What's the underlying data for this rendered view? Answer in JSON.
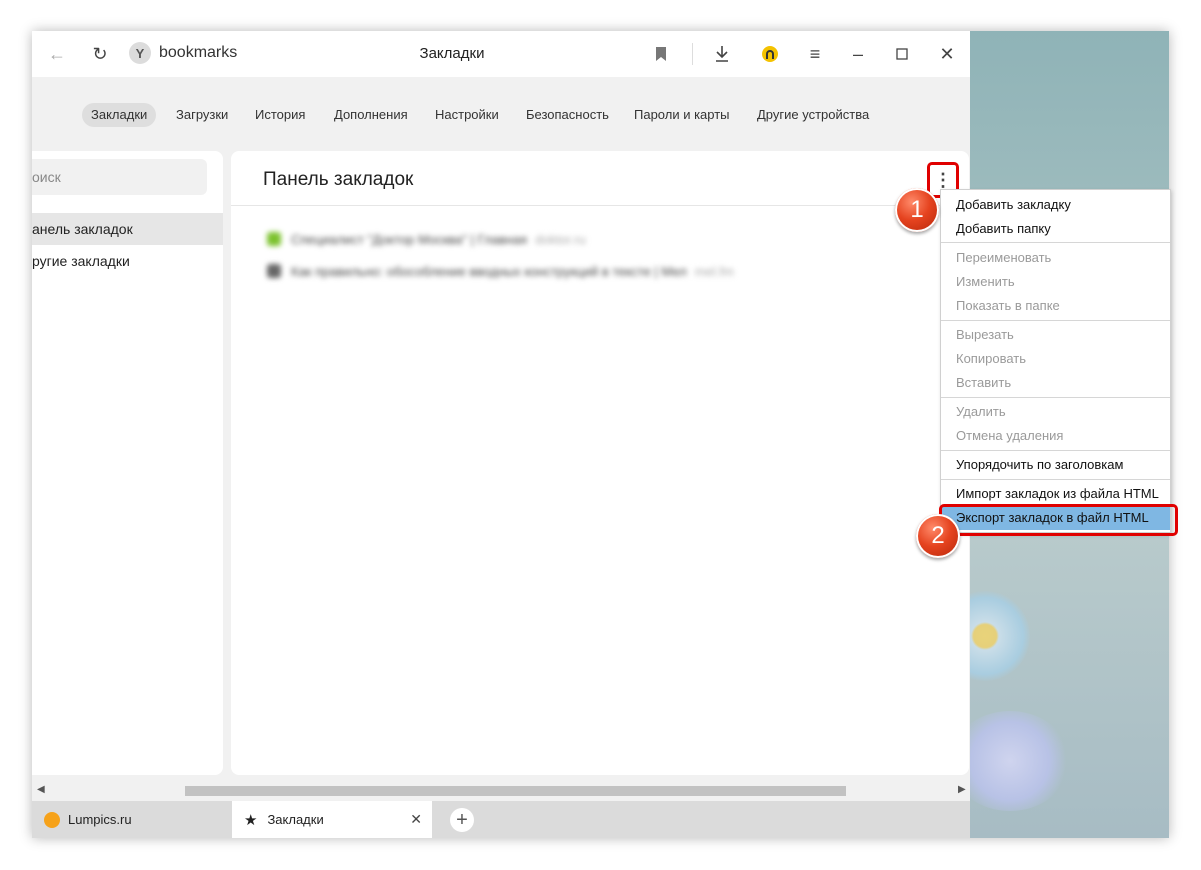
{
  "titlebar": {
    "address": "bookmarks",
    "title": "Закладки"
  },
  "nav_tabs": [
    {
      "label": "Закладки",
      "active": true
    },
    {
      "label": "Загрузки"
    },
    {
      "label": "История"
    },
    {
      "label": "Дополнения"
    },
    {
      "label": "Настройки"
    },
    {
      "label": "Безопасность"
    },
    {
      "label": "Пароли и карты"
    },
    {
      "label": "Другие устройства"
    }
  ],
  "sidebar": {
    "search_placeholder": "оиск",
    "items": [
      {
        "label": "анель закладок",
        "selected": true
      },
      {
        "label": "ругие закладки"
      }
    ]
  },
  "main": {
    "title": "Панель закладок",
    "bookmarks_blurred": [
      {
        "text": "Специалист \"Доктор Москва\" | Главная",
        "url": "doktor.ru"
      },
      {
        "text": "Как правильно: обособление вводных конструкций в тексте | Мел",
        "url": "mel.fm"
      }
    ]
  },
  "context_menu": {
    "items": [
      {
        "label": "Добавить закладку",
        "enabled": true
      },
      {
        "label": "Добавить папку",
        "enabled": true
      },
      {
        "label": "Переименовать",
        "enabled": false
      },
      {
        "label": "Изменить",
        "enabled": false
      },
      {
        "label": "Показать в папке",
        "enabled": false
      },
      {
        "label": "Вырезать",
        "enabled": false
      },
      {
        "label": "Копировать",
        "enabled": false
      },
      {
        "label": "Вставить",
        "enabled": false
      },
      {
        "label": "Удалить",
        "enabled": false
      },
      {
        "label": "Отмена удаления",
        "enabled": false
      },
      {
        "label": "Упорядочить по заголовкам",
        "enabled": true
      },
      {
        "label": "Импорт закладок из файла HTML",
        "enabled": true
      },
      {
        "label": "Экспорт закладок в файл HTML",
        "enabled": true,
        "highlighted": true
      }
    ]
  },
  "tabs": [
    {
      "label": "Lumpics.ru"
    },
    {
      "label": "Закладки",
      "active": true
    }
  ],
  "badges": [
    "1",
    "2"
  ],
  "colors": {
    "accent_red": "#e00000",
    "highlight_blue": "#7fb7e3",
    "badge_orange": "#e5431f"
  }
}
